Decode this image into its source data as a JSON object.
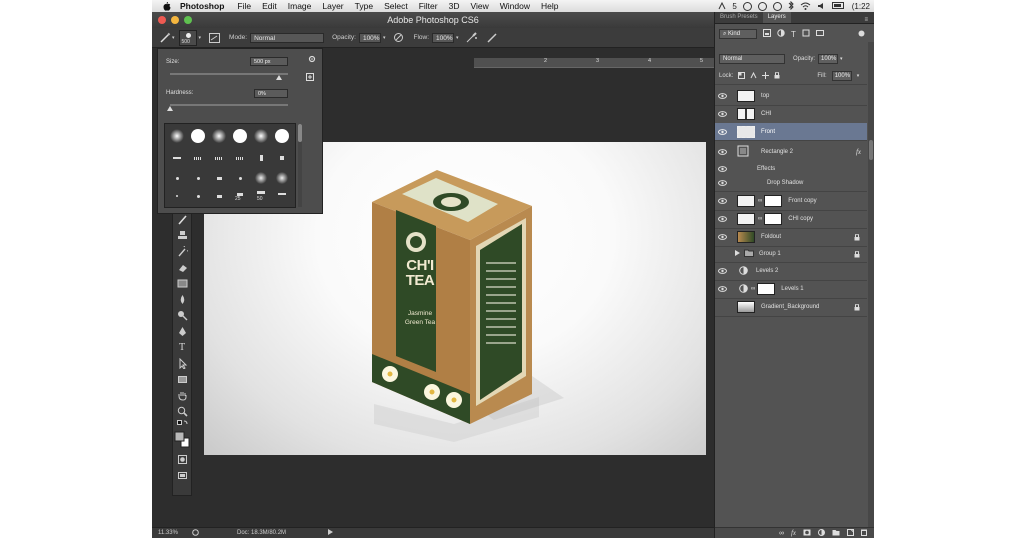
{
  "menubar": {
    "apple": "",
    "app_name": "Photoshop",
    "items": [
      "File",
      "Edit",
      "Image",
      "Layer",
      "Type",
      "Select",
      "Filter",
      "3D",
      "View",
      "Window",
      "Help"
    ],
    "status_text": "5",
    "clock": "(1:22"
  },
  "window": {
    "title": "Adobe Photoshop CS6"
  },
  "options_bar": {
    "brush_size": "500",
    "mode_label": "Mode:",
    "mode_value": "Normal",
    "opacity_label": "Opacity:",
    "opacity_value": "100%",
    "flow_label": "Flow:",
    "flow_value": "100%"
  },
  "brush_picker": {
    "size_label": "Size:",
    "size_value": "500 px",
    "hardness_label": "Hardness:",
    "hardness_value": "0%",
    "size_numbers": [
      "25",
      "50"
    ]
  },
  "ruler": {
    "ticks": [
      "2",
      "3",
      "4",
      "5",
      "6",
      "7",
      "8"
    ]
  },
  "canvas": {
    "box_title": "CH'I TEA",
    "box_subtitle_1": "Jasmine",
    "box_subtitle_2": "Green Tea"
  },
  "status_bar": {
    "zoom": "11.33%",
    "doc_label": "Doc: 18.3M/80.2M"
  },
  "panels": {
    "tabs": [
      "Brush Presets",
      "Layers"
    ],
    "active_tab": "Layers",
    "kind_label": "Kind",
    "blend_mode": "Normal",
    "opacity_label": "Opacity:",
    "opacity_value": "100%",
    "lock_label": "Lock:",
    "fill_label": "Fill:",
    "fill_value": "100%",
    "layers": [
      {
        "name": "top"
      },
      {
        "name": "CHI"
      },
      {
        "name": "Front"
      },
      {
        "name": "Rectangle 2"
      },
      {
        "name": "Effects"
      },
      {
        "name": "Drop Shadow"
      },
      {
        "name": "Front copy"
      },
      {
        "name": "CHI copy"
      },
      {
        "name": "Foldout"
      },
      {
        "name": "Group 1"
      },
      {
        "name": "Levels 2"
      },
      {
        "name": "Levels 1"
      },
      {
        "name": "Gradient_Background"
      }
    ]
  },
  "colors": {
    "ps_bg": "#2d2d2d",
    "panel_bg": "#535353",
    "selection": "#6a7892",
    "box_green": "#2f4a26",
    "box_brown": "#b98a4f"
  }
}
